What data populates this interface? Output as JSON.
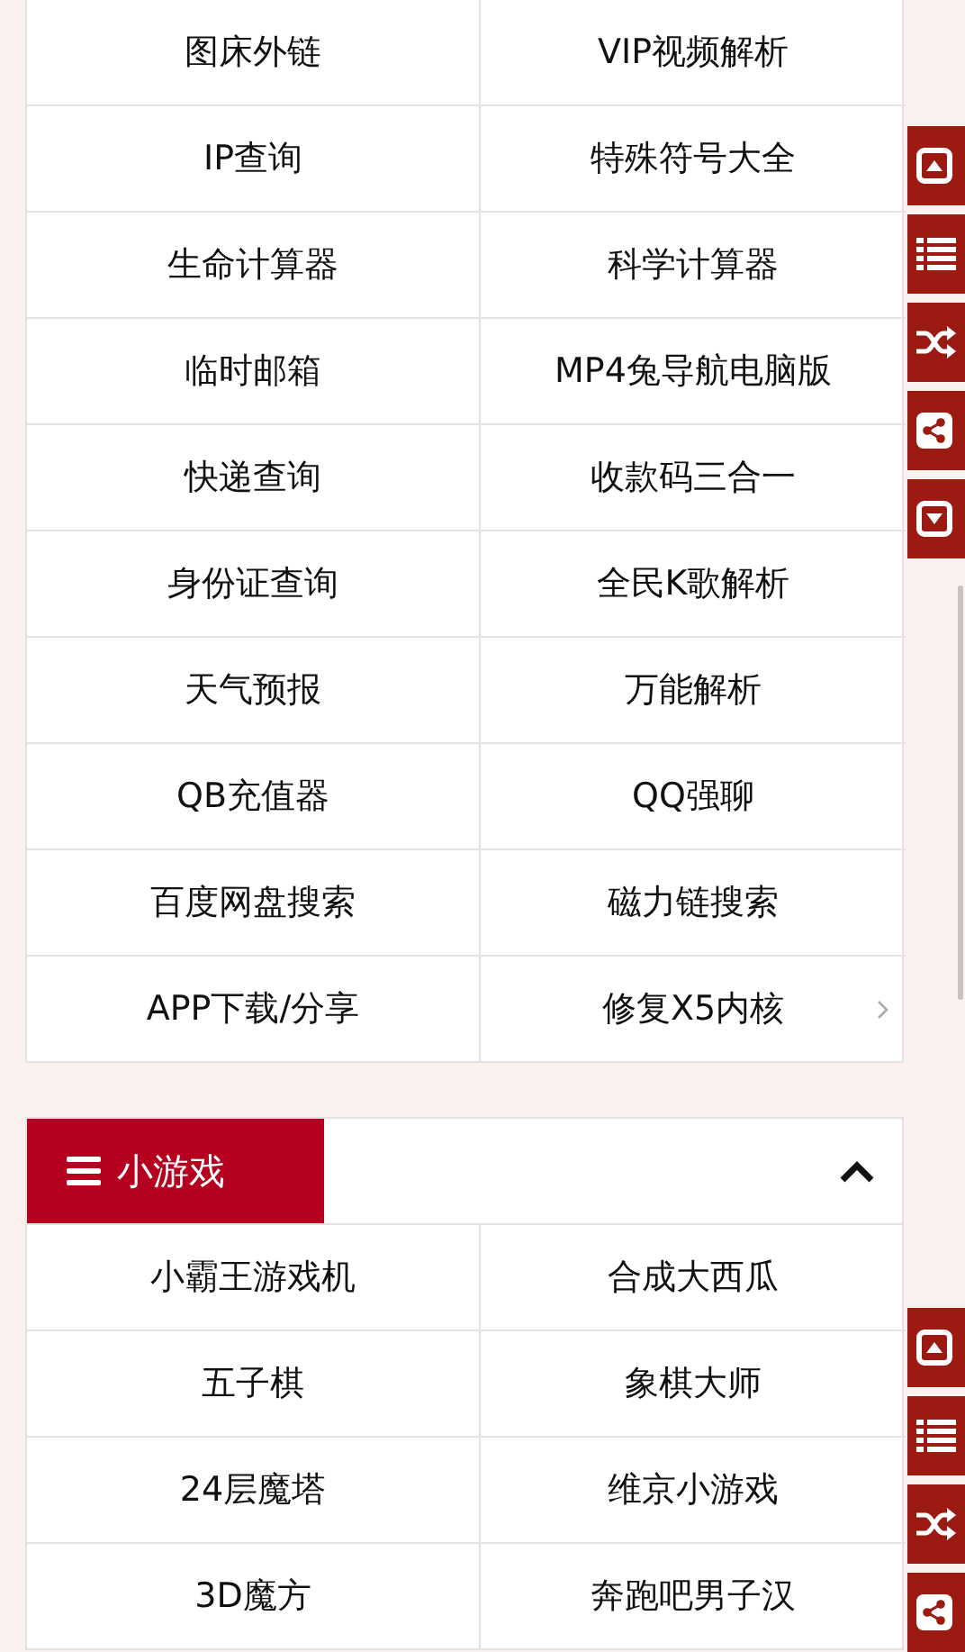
{
  "tools": {
    "items": [
      {
        "label": "图床外链"
      },
      {
        "label": "VIP视频解析"
      },
      {
        "label": "IP查询"
      },
      {
        "label": "特殊符号大全"
      },
      {
        "label": "生命计算器"
      },
      {
        "label": "科学计算器"
      },
      {
        "label": "临时邮箱"
      },
      {
        "label": "MP4兔导航电脑版"
      },
      {
        "label": "快递查询"
      },
      {
        "label": "收款码三合一"
      },
      {
        "label": "身份证查询"
      },
      {
        "label": "全民K歌解析"
      },
      {
        "label": "天气预报"
      },
      {
        "label": "万能解析"
      },
      {
        "label": "QB充值器"
      },
      {
        "label": "QQ强聊"
      },
      {
        "label": "百度网盘搜索"
      },
      {
        "label": "磁力链搜索"
      },
      {
        "label": "APP下载/分享"
      },
      {
        "label": "修复X5内核"
      }
    ]
  },
  "games": {
    "title": "小游戏",
    "expanded": true,
    "items": [
      {
        "label": "小霸王游戏机"
      },
      {
        "label": "合成大西瓜"
      },
      {
        "label": "五子棋"
      },
      {
        "label": "象棋大师"
      },
      {
        "label": "24层魔塔"
      },
      {
        "label": "维京小游戏"
      },
      {
        "label": "3D魔方"
      },
      {
        "label": "奔跑吧男子汉"
      }
    ]
  },
  "float_buttons_top": [
    {
      "kind": "top"
    },
    {
      "kind": "list"
    },
    {
      "kind": "random"
    },
    {
      "kind": "share"
    },
    {
      "kind": "bottom"
    }
  ],
  "float_buttons_bottom": [
    {
      "kind": "top"
    },
    {
      "kind": "list"
    },
    {
      "kind": "random"
    },
    {
      "kind": "share"
    }
  ]
}
